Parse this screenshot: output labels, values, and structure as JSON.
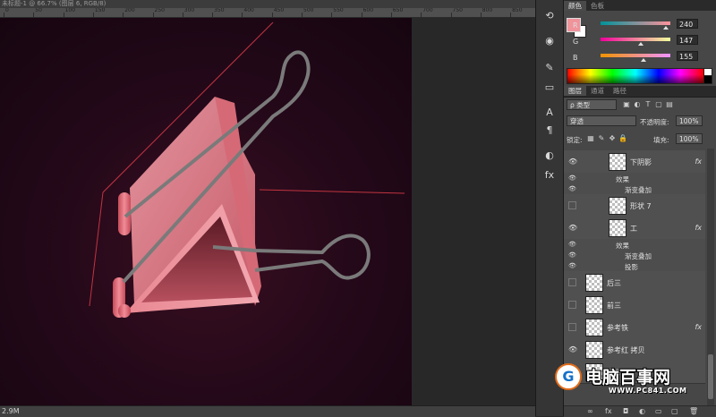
{
  "document": {
    "tab_title": "未标题-1 @ 66.7% (图层 6, RGB/8)",
    "ruler_labels": [
      "0",
      "50",
      "100",
      "150",
      "200",
      "250",
      "300",
      "350",
      "400",
      "450",
      "500",
      "550",
      "600",
      "650",
      "700",
      "750",
      "800",
      "850"
    ],
    "status_text": "2.9M"
  },
  "color_panel": {
    "tabs": [
      "颜色",
      "色板"
    ],
    "foreground_color": "#f0939b",
    "channels": [
      {
        "label": "R",
        "value": "240",
        "fraction": 0.94
      },
      {
        "label": "G",
        "value": "147",
        "fraction": 0.58
      },
      {
        "label": "B",
        "value": "155",
        "fraction": 0.61
      }
    ]
  },
  "layers_panel": {
    "tabs": [
      "图层",
      "通道",
      "路径"
    ],
    "filter_label": "ρ 类型",
    "blend_mode": "穿透",
    "opacity_label": "不透明度:",
    "opacity_value": "100%",
    "lock_label": "锁定:",
    "fill_label": "填充:",
    "fill_value": "100%",
    "layers": [
      {
        "name": "下阴影",
        "visible": true,
        "fx": true,
        "sublabels": [
          "效果",
          "渐变叠加"
        ]
      },
      {
        "name": "形状 7",
        "visible": false,
        "fx": false,
        "sublabels": []
      },
      {
        "name": "工",
        "visible": true,
        "fx": true,
        "sublabels": [
          "效果",
          "渐变叠加",
          "投影"
        ]
      },
      {
        "name": "后三",
        "visible": false,
        "fx": false,
        "sublabels": []
      },
      {
        "name": "前三",
        "visible": false,
        "fx": false,
        "sublabels": []
      },
      {
        "name": "参考铁",
        "visible": false,
        "fx": true,
        "sublabels": []
      },
      {
        "name": "参考红 拷贝",
        "visible": true,
        "fx": false,
        "sublabels": []
      },
      {
        "name": "参考红",
        "visible": true,
        "fx": false,
        "sublabels": []
      }
    ],
    "bottom_icons": [
      "link-icon",
      "fx-icon",
      "mask-icon",
      "adjustment-icon",
      "group-icon",
      "new-layer-icon",
      "trash-icon"
    ]
  },
  "left_strip_icons": [
    "history-icon",
    "properties-icon",
    "brush-icon",
    "swatch-icon",
    "character-icon",
    "paragraph-icon",
    "color-wheel-icon",
    "fx-icon"
  ],
  "watermark": {
    "logo_letter": "G",
    "title": "电脑百事网",
    "url": "WWW.PC841.COM"
  }
}
